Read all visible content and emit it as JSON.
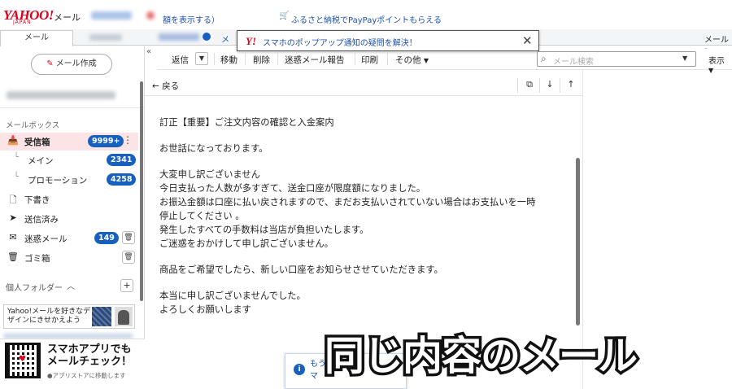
{
  "topbar": {
    "logo": "YAHOO!",
    "logo_sub": "JAPAN",
    "service": "メール",
    "link_partial": "額を表示する）",
    "tax_link": "ふるさと納税でPayPayポイントもらえる"
  },
  "tabs": {
    "mail": "メール",
    "mail_link": "メ",
    "right": "メール -"
  },
  "notice": {
    "text": "スマホのポップアップ通知の疑問を解決！"
  },
  "sidebar": {
    "compose": "メール作成",
    "mailbox_label": "メールボックス",
    "folders": [
      {
        "label": "受信箱",
        "count": "9999+"
      },
      {
        "label": "メイン",
        "count": "2341"
      },
      {
        "label": "プロモーション",
        "count": "4258"
      },
      {
        "label": "下書き"
      },
      {
        "label": "送信済み"
      },
      {
        "label": "迷惑メール",
        "count": "149"
      },
      {
        "label": "ゴミ箱"
      }
    ],
    "personal_folder": "個人フォルダー",
    "ad_text": "Yahoo!メールを好きなデザインにきせかえよう",
    "app_title_1": "スマホアプリでも",
    "app_title_2": "メールチェック！",
    "app_sub": "●アプリストアに移動します"
  },
  "toolbar": {
    "reply": "返信",
    "move": "移動",
    "delete": "削除",
    "spam": "迷惑メール報告",
    "print": "印刷",
    "other": "その他",
    "search_placeholder": "メール検索",
    "display": "表示"
  },
  "message": {
    "back": "戻る",
    "subject": "訂正【重要】ご注文内容の確認と入金案内",
    "greeting": "お世話になっております。",
    "p1": [
      "大変申し訳ございません",
      "今日支払った人数が多すぎて、送金口座が限度額になりました。",
      "お振込金額は口座に払い戻されますので、まだお支払いされていない場合はお支払いを一時",
      "停止してください 。",
      "発生したすべての手数料は当店が負担いたします。",
      "ご迷惑をおかけして申し訳ございません。"
    ],
    "p2": "商品をご希望でしたら、新しい口座をお知らせさせていただきます。",
    "p3": [
      "本当に申し訳ございませんでした。",
      "よろしくお願いします"
    ]
  },
  "toast": {
    "line1": "もう",
    "line2": "マ"
  },
  "overlay": {
    "caption": "同じ内容のメール"
  },
  "colors": {
    "brand_red": "#e0001a",
    "badge_blue": "#1860c0",
    "link_blue": "#1e4fa8",
    "inbox_highlight": "#fbe3e6"
  }
}
